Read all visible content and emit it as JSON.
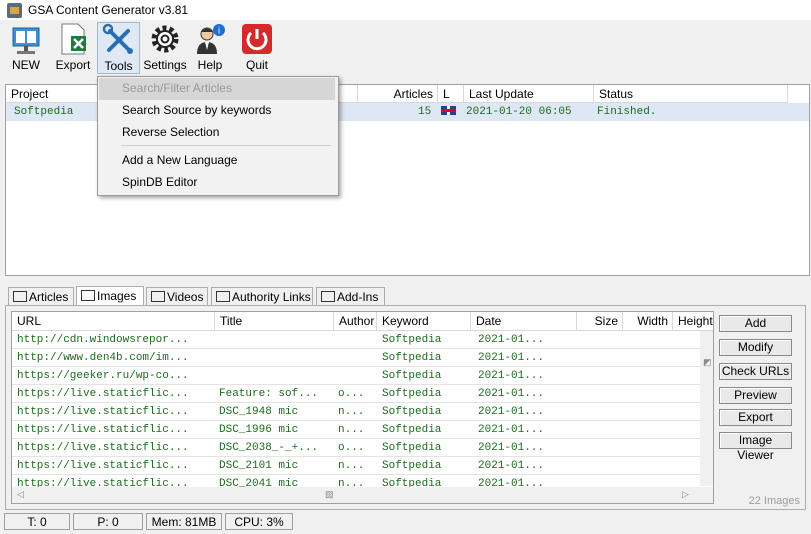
{
  "window": {
    "title": "GSA Content Generator v3.81"
  },
  "toolbar": {
    "buttons": [
      {
        "label": "NEW",
        "icon": "book-icon"
      },
      {
        "label": "Export",
        "icon": "excel-export-icon"
      },
      {
        "label": "Tools",
        "icon": "wrench-screwdriver-icon",
        "active": true
      },
      {
        "label": "Settings",
        "icon": "gear-icon"
      },
      {
        "label": "Help",
        "icon": "help-person-icon"
      },
      {
        "label": "Quit",
        "icon": "power-icon"
      }
    ]
  },
  "projects": {
    "columns": [
      "Project",
      "Articles",
      "L",
      "Last Update",
      "Status"
    ],
    "rows": [
      {
        "project": "Softpedia",
        "articles": "15",
        "language_flag": "uk-flag",
        "last_update": "2021-01-20 06:05",
        "status": "Finished."
      }
    ]
  },
  "tools_menu": {
    "items": [
      {
        "label": "Search/Filter Articles",
        "disabled": true
      },
      {
        "label": "Search Source by keywords"
      },
      {
        "label": "Reverse Selection"
      },
      {
        "label": "Add a New Language"
      },
      {
        "label": "SpinDB Editor"
      }
    ]
  },
  "tabs": [
    {
      "label": "Articles",
      "icon": "articles-icon"
    },
    {
      "label": "Images",
      "icon": "images-icon",
      "selected": true
    },
    {
      "label": "Videos",
      "icon": "videos-icon"
    },
    {
      "label": "Authority Links",
      "icon": "link-icon"
    },
    {
      "label": "Add-Ins",
      "icon": "puzzle-icon"
    }
  ],
  "images": {
    "columns": [
      "URL",
      "Title",
      "Author",
      "Keyword",
      "Date",
      "Size",
      "Width",
      "Height"
    ],
    "rows": [
      {
        "url": "http://cdn.windowsrepor...",
        "title": "",
        "author": "",
        "keyword": "Softpedia",
        "date": "2021-01..."
      },
      {
        "url": "http://www.den4b.com/im...",
        "title": "",
        "author": "",
        "keyword": "Softpedia",
        "date": "2021-01..."
      },
      {
        "url": "https://geeker.ru/wp-co...",
        "title": "",
        "author": "",
        "keyword": "Softpedia",
        "date": "2021-01..."
      },
      {
        "url": "https://live.staticflic...",
        "title": "Feature: sof...",
        "author": "o...",
        "keyword": "Softpedia",
        "date": "2021-01..."
      },
      {
        "url": "https://live.staticflic...",
        "title": "DSC_1948 mic",
        "author": "n...",
        "keyword": "Softpedia",
        "date": "2021-01..."
      },
      {
        "url": "https://live.staticflic...",
        "title": "DSC_1996 mic",
        "author": "n...",
        "keyword": "Softpedia",
        "date": "2021-01..."
      },
      {
        "url": "https://live.staticflic...",
        "title": "DSC_2038_-_+...",
        "author": "o...",
        "keyword": "Softpedia",
        "date": "2021-01..."
      },
      {
        "url": "https://live.staticflic...",
        "title": "DSC_2101 mic",
        "author": "n...",
        "keyword": "Softpedia",
        "date": "2021-01..."
      },
      {
        "url": "https://live.staticflic...",
        "title": "DSC_2041 mic",
        "author": "n...",
        "keyword": "Softpedia",
        "date": "2021-01..."
      }
    ],
    "side_buttons": [
      "Add",
      "Modify",
      "Check URLs",
      "Preview",
      "Export",
      "Image Viewer"
    ],
    "count_label": "22 Images"
  },
  "status": {
    "threads": "T: 0",
    "proxies": "P: 0",
    "memory": "Mem: 81MB",
    "cpu": "CPU: 3%"
  },
  "colors": {
    "data_text": "#1d6b1d",
    "selected_row": "#dde8f4",
    "quit_red": "#d42a2a"
  }
}
